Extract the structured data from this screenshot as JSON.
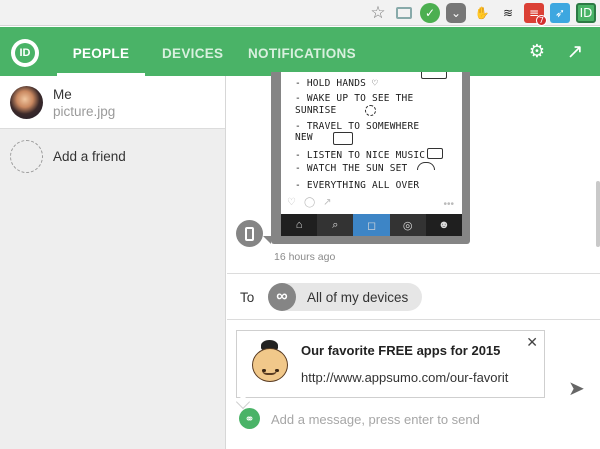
{
  "extension_bar": {
    "icons": [
      "star-icon",
      "cast-icon",
      "green-extension-icon",
      "pocket-icon",
      "hand-icon",
      "buffer-icon",
      "todoist-icon",
      "bird-icon",
      "pushbullet-icon"
    ],
    "todoist_badge": "7"
  },
  "header": {
    "tabs": [
      {
        "label": "PEOPLE",
        "active": true
      },
      {
        "label": "DEVICES",
        "active": false
      },
      {
        "label": "NOTIFICATIONS",
        "active": false
      }
    ],
    "brand_color": "#4ab367"
  },
  "sidebar": {
    "people": [
      {
        "name": "Me",
        "subtitle": "picture.jpg"
      }
    ],
    "add_friend_label": "Add a friend"
  },
  "thread": {
    "image_lines": [
      "- HOLD HANDS ♡",
      "- WAKE UP TO SEE THE",
      "  SUNRISE",
      "- TRAVEL TO SOMEWHERE",
      "  NEW",
      "- LISTEN TO NICE MUSIC",
      "- WATCH THE SUN SET",
      "- EVERYTHING ALL OVER"
    ],
    "timestamp": "16 hours ago"
  },
  "to_row": {
    "label": "To",
    "target": "All of my devices"
  },
  "compose": {
    "link_card": {
      "title": "Our favorite FREE apps for 2015",
      "url": "http://www.appsumo.com/our-favorit"
    },
    "placeholder": "Add a message, press enter to send"
  }
}
